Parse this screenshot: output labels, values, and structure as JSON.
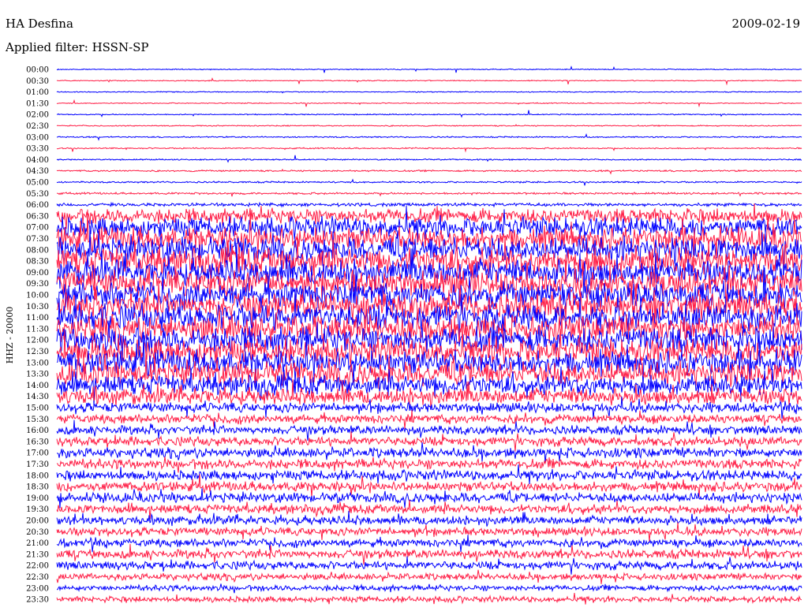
{
  "header": {
    "station": "HA Desfina",
    "filter_prefix": "Applied filter:",
    "filter": "HSSN-SP",
    "date": "2009-02-19"
  },
  "chart_data": {
    "type": "line",
    "title": "HA Desfina",
    "subtitle": "2009-02-19",
    "ylabel": "HHZ - 20000",
    "colors": [
      "#0000ff",
      "#ff1e46"
    ],
    "grid": false,
    "legend": "none",
    "rows": [
      {
        "time": "00:00",
        "color": "#0000ff",
        "noise": 0.06
      },
      {
        "time": "00:30",
        "color": "#ff1e46",
        "noise": 0.06
      },
      {
        "time": "01:00",
        "color": "#0000ff",
        "noise": 0.06
      },
      {
        "time": "01:30",
        "color": "#ff1e46",
        "noise": 0.06
      },
      {
        "time": "02:00",
        "color": "#0000ff",
        "noise": 0.07
      },
      {
        "time": "02:30",
        "color": "#ff1e46",
        "noise": 0.07
      },
      {
        "time": "03:00",
        "color": "#0000ff",
        "noise": 0.08
      },
      {
        "time": "03:30",
        "color": "#ff1e46",
        "noise": 0.08
      },
      {
        "time": "04:00",
        "color": "#0000ff",
        "noise": 0.08
      },
      {
        "time": "04:30",
        "color": "#ff1e46",
        "noise": 0.1
      },
      {
        "time": "05:00",
        "color": "#0000ff",
        "noise": 0.1
      },
      {
        "time": "05:30",
        "color": "#ff1e46",
        "noise": 0.12
      },
      {
        "time": "06:00",
        "color": "#0000ff",
        "noise": 0.2
      },
      {
        "time": "06:30",
        "color": "#ff1e46",
        "noise": 0.9
      },
      {
        "time": "07:00",
        "color": "#0000ff",
        "noise": 1.2
      },
      {
        "time": "07:30",
        "color": "#ff1e46",
        "noise": 1.4
      },
      {
        "time": "08:00",
        "color": "#0000ff",
        "noise": 1.5
      },
      {
        "time": "08:30",
        "color": "#ff1e46",
        "noise": 1.6
      },
      {
        "time": "09:00",
        "color": "#0000ff",
        "noise": 1.6
      },
      {
        "time": "09:30",
        "color": "#ff1e46",
        "noise": 1.6
      },
      {
        "time": "10:00",
        "color": "#0000ff",
        "noise": 1.6
      },
      {
        "time": "10:30",
        "color": "#ff1e46",
        "noise": 1.6
      },
      {
        "time": "11:00",
        "color": "#0000ff",
        "noise": 1.6
      },
      {
        "time": "11:30",
        "color": "#ff1e46",
        "noise": 1.6
      },
      {
        "time": "12:00",
        "color": "#0000ff",
        "noise": 1.6
      },
      {
        "time": "12:30",
        "color": "#ff1e46",
        "noise": 1.5
      },
      {
        "time": "13:00",
        "color": "#0000ff",
        "noise": 1.5
      },
      {
        "time": "13:30",
        "color": "#ff1e46",
        "noise": 1.4
      },
      {
        "time": "14:00",
        "color": "#0000ff",
        "noise": 1.2
      },
      {
        "time": "14:30",
        "color": "#ff1e46",
        "noise": 1.0
      },
      {
        "time": "15:00",
        "color": "#0000ff",
        "noise": 0.6
      },
      {
        "time": "15:30",
        "color": "#ff1e46",
        "noise": 0.55
      },
      {
        "time": "16:00",
        "color": "#0000ff",
        "noise": 0.55
      },
      {
        "time": "16:30",
        "color": "#ff1e46",
        "noise": 0.55
      },
      {
        "time": "17:00",
        "color": "#0000ff",
        "noise": 0.6
      },
      {
        "time": "17:30",
        "color": "#ff1e46",
        "noise": 0.6
      },
      {
        "time": "18:00",
        "color": "#0000ff",
        "noise": 0.6
      },
      {
        "time": "18:30",
        "color": "#ff1e46",
        "noise": 0.6
      },
      {
        "time": "19:00",
        "color": "#0000ff",
        "noise": 0.6
      },
      {
        "time": "19:30",
        "color": "#ff1e46",
        "noise": 0.55
      },
      {
        "time": "20:00",
        "color": "#0000ff",
        "noise": 0.55
      },
      {
        "time": "20:30",
        "color": "#ff1e46",
        "noise": 0.5
      },
      {
        "time": "21:00",
        "color": "#0000ff",
        "noise": 0.5
      },
      {
        "time": "21:30",
        "color": "#ff1e46",
        "noise": 0.55
      },
      {
        "time": "22:00",
        "color": "#0000ff",
        "noise": 0.5
      },
      {
        "time": "22:30",
        "color": "#ff1e46",
        "noise": 0.4
      },
      {
        "time": "23:00",
        "color": "#0000ff",
        "noise": 0.35
      },
      {
        "time": "23:30",
        "color": "#ff1e46",
        "noise": 0.35
      }
    ]
  }
}
